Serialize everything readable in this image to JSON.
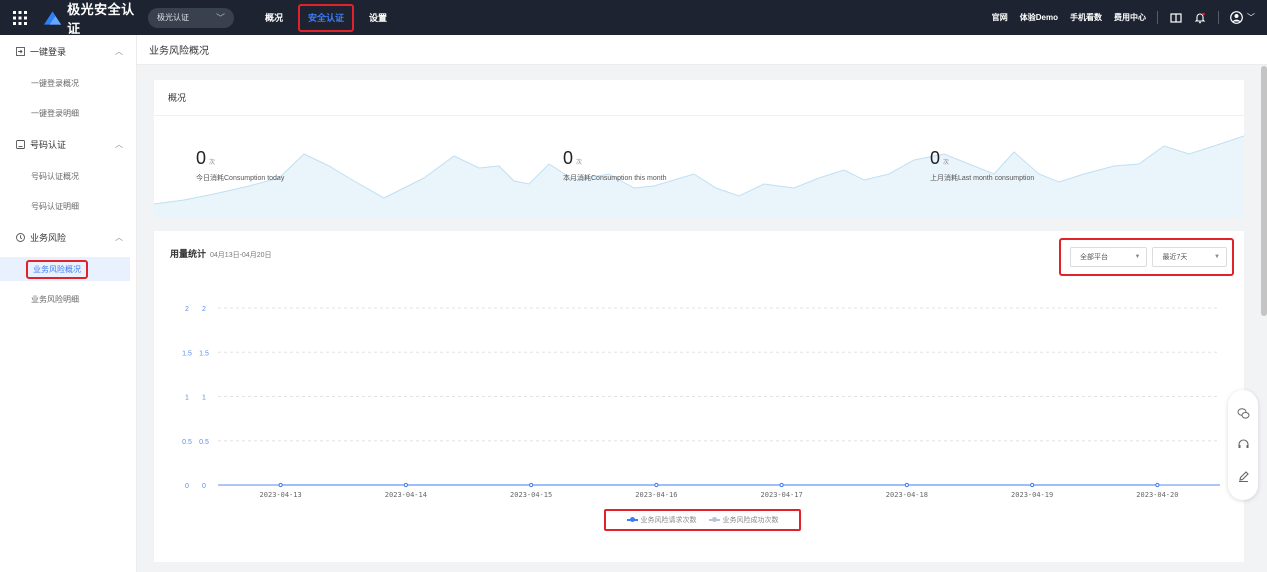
{
  "topbar": {
    "brand": "极光安全认证",
    "app_select": "极光认证",
    "nav": [
      {
        "label": "概况",
        "active": false
      },
      {
        "label": "安全认证",
        "active": true
      },
      {
        "label": "设置",
        "active": false
      }
    ],
    "links": [
      "官网",
      "体验Demo",
      "手机看数",
      "费用中心"
    ],
    "icons": [
      "apps-grid-icon",
      "book-icon",
      "bell-icon",
      "user-icon"
    ]
  },
  "sidebar": {
    "groups": [
      {
        "label": "一键登录",
        "icon": "login-icon",
        "items": [
          "一键登录概况",
          "一键登录明细"
        ]
      },
      {
        "label": "号码认证",
        "icon": "phone-verify-icon",
        "items": [
          "号码认证概况",
          "号码认证明细"
        ]
      },
      {
        "label": "业务风险",
        "icon": "risk-icon",
        "items": [
          "业务风险概况",
          "业务风险明细"
        ]
      }
    ],
    "active_item": "业务风险概况"
  },
  "page": {
    "title": "业务风险概况"
  },
  "overview": {
    "title": "概况",
    "stats": [
      {
        "value": "0",
        "unit": "次",
        "label": "今日消耗Consumption today"
      },
      {
        "value": "0",
        "unit": "次",
        "label": "本月消耗Consumption this month"
      },
      {
        "value": "0",
        "unit": "次",
        "label": "上月消耗Last month consumption"
      }
    ]
  },
  "usage": {
    "title": "用量统计",
    "range": "04月13日-04月20日",
    "platform_select": "全部平台",
    "period_select": "最近7天"
  },
  "colors": {
    "topbar_bg": "#1d2330",
    "accent": "#3d7cf5",
    "highlight_border": "#e0232a",
    "series1": "#3d7cf5",
    "series2": "#b8c4d6"
  },
  "chart_data": {
    "type": "line",
    "x": [
      "2023-04-13",
      "2023-04-14",
      "2023-04-15",
      "2023-04-16",
      "2023-04-17",
      "2023-04-18",
      "2023-04-19",
      "2023-04-20"
    ],
    "y_ticks": [
      0,
      0.5,
      1,
      1.5,
      2
    ],
    "ylim": [
      0,
      2
    ],
    "series": [
      {
        "name": "业务风险请求次数",
        "values": [
          0,
          0,
          0,
          0,
          0,
          0,
          0,
          0
        ]
      },
      {
        "name": "业务风险成功次数",
        "values": [
          0,
          0,
          0,
          0,
          0,
          0,
          0,
          0
        ]
      }
    ],
    "grid": true,
    "legend": "bottom"
  }
}
